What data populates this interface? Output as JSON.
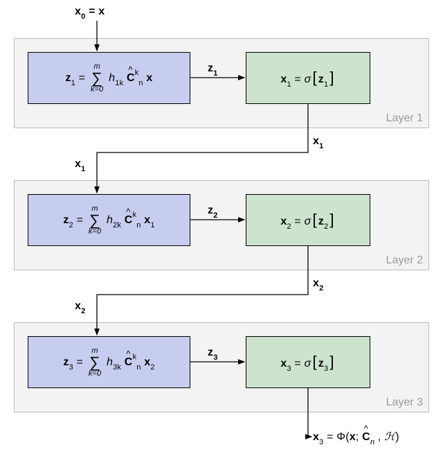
{
  "input_label_html": "<span class='bold'>x</span><span class='sub'>0</span> = <span class='bold'>x</span>",
  "layers": [
    {
      "label": "Layer 1",
      "filter_html": "<span class='bold'>z</span><span class='sub'>1</span> = <span class='frac'><span class='top'>m</span><span class='sym'>∑</span><span class='bot'>k=0</span></span> <span class='it'>h</span><span class='sub'>1k</span> <span class='hat-wrap'><span class='hat'>^</span><span class='bold'>C</span></span><span class='sup'>k</span><span class='sub'>n</span> <span class='bold'>x</span>",
      "act_html": "<span class='bold'>x</span><span class='sub'>1</span> = <span class='it'>σ</span><span class='bigl'>[</span><span class='bold'>z</span><span class='sub'>1</span><span class='bigl'>]</span>",
      "z_label_html": "<span class='bold'>z</span><span class='sub'>1</span>",
      "x_out_html": "<span class='bold'>x</span><span class='sub'>1</span>",
      "x_in_next_html": "<span class='bold'>x</span><span class='sub'>1</span>"
    },
    {
      "label": "Layer 2",
      "filter_html": "<span class='bold'>z</span><span class='sub'>2</span> = <span class='frac'><span class='top'>m</span><span class='sym'>∑</span><span class='bot'>k=0</span></span> <span class='it'>h</span><span class='sub'>2k</span> <span class='hat-wrap'><span class='hat'>^</span><span class='bold'>C</span></span><span class='sup'>k</span><span class='sub'>n</span> <span class='bold'>x</span><span class='sub'>1</span>",
      "act_html": "<span class='bold'>x</span><span class='sub'>2</span> = <span class='it'>σ</span><span class='bigl'>[</span><span class='bold'>z</span><span class='sub'>2</span><span class='bigl'>]</span>",
      "z_label_html": "<span class='bold'>z</span><span class='sub'>2</span>",
      "x_out_html": "<span class='bold'>x</span><span class='sub'>2</span>",
      "x_in_next_html": "<span class='bold'>x</span><span class='sub'>2</span>"
    },
    {
      "label": "Layer 3",
      "filter_html": "<span class='bold'>z</span><span class='sub'>3</span> = <span class='frac'><span class='top'>m</span><span class='sym'>∑</span><span class='bot'>k=0</span></span> <span class='it'>h</span><span class='sub'>3k</span> <span class='hat-wrap'><span class='hat'>^</span><span class='bold'>C</span></span><span class='sup'>k</span><span class='sub'>n</span> <span class='bold'>x</span><span class='sub'>2</span>",
      "act_html": "<span class='bold'>x</span><span class='sub'>3</span> = <span class='it'>σ</span><span class='bigl'>[</span><span class='bold'>z</span><span class='sub'>3</span><span class='bigl'>]</span>",
      "z_label_html": "<span class='bold'>z</span><span class='sub'>3</span>",
      "x_out_html": "",
      "x_in_next_html": ""
    }
  ],
  "final_html": "<span class='bold'>x</span><span class='sub'>3</span> = Φ(<span class='bold'>x</span>; <span class='hat-wrap'><span class='hat'>^</span><span class='bold'>C</span></span><span class='sub'><span class='it'>n</span></span> , <span class='it'>ℋ</span>)",
  "chart_data": {
    "type": "flow-diagram",
    "input": "x0 = x",
    "output": "x3 = Phi(x; C_hat_n, H)",
    "layers": [
      {
        "name": "Layer 1",
        "filter": "z1 = sum_{k=0}^{m} h_{1k} C_hat_n^k x",
        "activation": "x1 = sigma[z1]"
      },
      {
        "name": "Layer 2",
        "filter": "z2 = sum_{k=0}^{m} h_{2k} C_hat_n^k x1",
        "activation": "x2 = sigma[z2]"
      },
      {
        "name": "Layer 3",
        "filter": "z3 = sum_{k=0}^{m} h_{3k} C_hat_n^k x2",
        "activation": "x3 = sigma[z3]"
      }
    ],
    "edges": [
      {
        "from": "input",
        "to": "Layer1.filter"
      },
      {
        "from": "Layer1.filter",
        "to": "Layer1.activation",
        "label": "z1"
      },
      {
        "from": "Layer1.activation",
        "to": "Layer2.filter",
        "label": "x1"
      },
      {
        "from": "Layer2.filter",
        "to": "Layer2.activation",
        "label": "z2"
      },
      {
        "from": "Layer2.activation",
        "to": "Layer3.filter",
        "label": "x2"
      },
      {
        "from": "Layer3.filter",
        "to": "Layer3.activation",
        "label": "z3"
      },
      {
        "from": "Layer3.activation",
        "to": "output",
        "label": "x3"
      }
    ]
  }
}
